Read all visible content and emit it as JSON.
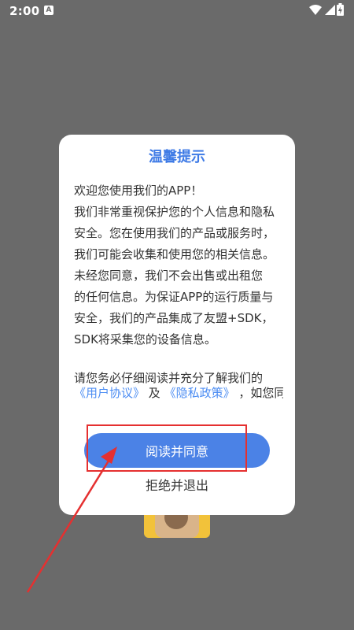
{
  "status_bar": {
    "time": "2:00",
    "notif_icon_glyph": "A"
  },
  "dialog": {
    "title": "温馨提示",
    "lines": [
      "欢迎您使用我们的APP！",
      "我们非常重视保护您的个人信息和隐私",
      "安全。您在使用我们的产品或服务时，",
      "我们可能会收集和使用您的相关信息。",
      "未经您同意，我们不会出售或出租您",
      "的任何信息。为保证APP的运行质量与",
      "安全，我们的产品集成了友盟+SDK，",
      "SDK将采集您的设备信息。"
    ],
    "read_prompt": "请您务必仔细阅读并充分了解我们的",
    "user_agreement": "《用户协议》",
    "and": "及",
    "privacy_policy": "《隐私政策》",
    "if_agree": "，如您同",
    "agree_button": "阅读并同意",
    "decline_button": "拒绝并退出"
  },
  "colors": {
    "overlay": "#6a6a6a",
    "accent": "#4b82e6",
    "title": "#3f7be6",
    "link": "#4c8df3",
    "annotation": "#e53030"
  }
}
